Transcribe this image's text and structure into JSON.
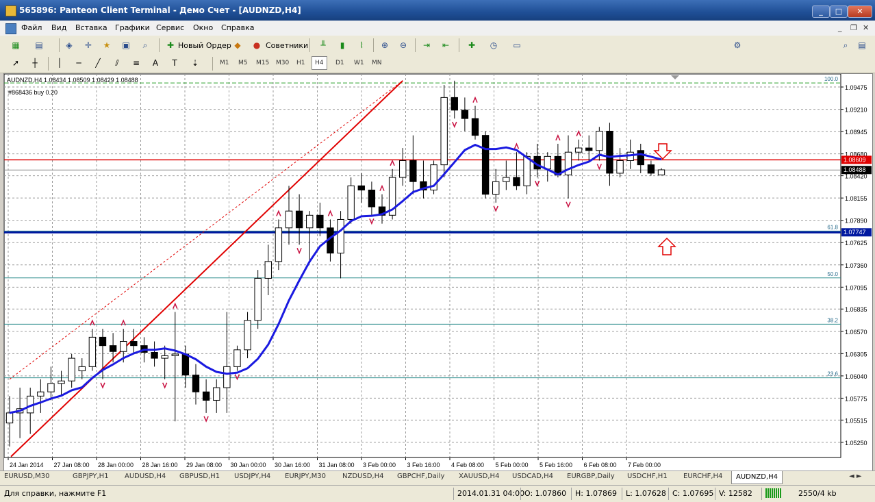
{
  "window": {
    "title": "565896: Panteon Client Terminal - Демо Счет - [AUDNZD,H4]"
  },
  "menu": [
    "Файл",
    "Вид",
    "Вставка",
    "Графики",
    "Сервис",
    "Окно",
    "Справка"
  ],
  "toolbar": {
    "new_order": "Новый Ордер",
    "advisors": "Советники"
  },
  "timeframes": [
    "M1",
    "M5",
    "M15",
    "M30",
    "H1",
    "H4",
    "D1",
    "W1",
    "MN"
  ],
  "active_timeframe": "H4",
  "chart_data": {
    "type": "candlestick",
    "header": "AUDNZD,H4  1.08434 1.08509 1.08429 1.08488",
    "order_label": "#868436 buy 0.20",
    "ylim": [
      1.0507,
      1.0963
    ],
    "y_ticks": [
      "1.09475",
      "1.09210",
      "1.08945",
      "1.08680",
      "1.08420",
      "1.08155",
      "1.07890",
      "1.07625",
      "1.07360",
      "1.07095",
      "1.06835",
      "1.06570",
      "1.06305",
      "1.06040",
      "1.05775",
      "1.05515",
      "1.05250"
    ],
    "x_ticks": [
      "24 Jan 2014",
      "27 Jan 08:00",
      "28 Jan 00:00",
      "28 Jan 16:00",
      "29 Jan 08:00",
      "30 Jan 00:00",
      "30 Jan 16:00",
      "31 Jan 08:00",
      "3 Feb 00:00",
      "3 Feb 16:00",
      "4 Feb 08:00",
      "5 Feb 00:00",
      "5 Feb 16:00",
      "6 Feb 08:00",
      "7 Feb 00:00"
    ],
    "fib_levels": [
      {
        "label": "100.0",
        "value": 1.09523
      },
      {
        "label": "61.8",
        "value": 1.07762
      },
      {
        "label": "50.0",
        "value": 1.07205
      },
      {
        "label": "38.2",
        "value": 1.06655
      },
      {
        "label": "23.6",
        "value": 1.06018
      }
    ],
    "price_lines": [
      {
        "label": "1.08609",
        "value": 1.08609,
        "color": "#e00000"
      },
      {
        "label": "1.08488",
        "value": 1.08488,
        "color": "#000000"
      },
      {
        "label": "1.07747",
        "value": 1.07747,
        "color": "#0018a0"
      }
    ],
    "candles": [
      [
        1.0548,
        1.058,
        1.052,
        1.056
      ],
      [
        1.056,
        1.059,
        1.053,
        1.0565
      ],
      [
        1.056,
        1.059,
        1.0535,
        1.058
      ],
      [
        1.058,
        1.06,
        1.056,
        1.0585
      ],
      [
        1.0585,
        1.0615,
        1.0575,
        1.0595
      ],
      [
        1.0595,
        1.061,
        1.058,
        1.0598
      ],
      [
        1.0598,
        1.063,
        1.059,
        1.0625
      ],
      [
        1.061,
        1.0625,
        1.06,
        1.0615
      ],
      [
        1.0615,
        1.066,
        1.061,
        1.065
      ],
      [
        1.065,
        1.066,
        1.06,
        1.064
      ],
      [
        1.064,
        1.0655,
        1.062,
        1.0633
      ],
      [
        1.0633,
        1.066,
        1.062,
        1.0645
      ],
      [
        1.0645,
        1.066,
        1.063,
        1.064
      ],
      [
        1.064,
        1.065,
        1.062,
        1.0632
      ],
      [
        1.0632,
        1.0645,
        1.0615,
        1.0625
      ],
      [
        1.0625,
        1.064,
        1.06,
        1.0628
      ],
      [
        1.0628,
        1.068,
        1.055,
        1.063
      ],
      [
        1.063,
        1.064,
        1.059,
        1.0605
      ],
      [
        1.0605,
        1.0618,
        1.057,
        1.0585
      ],
      [
        1.0585,
        1.06,
        1.056,
        1.0575
      ],
      [
        1.0575,
        1.06,
        1.056,
        1.059
      ],
      [
        1.059,
        1.068,
        1.056,
        1.0615
      ],
      [
        1.0615,
        1.064,
        1.061,
        1.0635
      ],
      [
        1.0635,
        1.068,
        1.0625,
        1.067
      ],
      [
        1.067,
        1.073,
        1.066,
        1.072
      ],
      [
        1.072,
        1.076,
        1.07,
        1.074
      ],
      [
        1.074,
        1.079,
        1.073,
        1.078
      ],
      [
        1.078,
        1.083,
        1.076,
        1.08
      ],
      [
        1.08,
        1.082,
        1.076,
        1.078
      ],
      [
        1.078,
        1.08,
        1.074,
        1.0795
      ],
      [
        1.0795,
        1.081,
        1.077,
        1.078
      ],
      [
        1.078,
        1.079,
        1.074,
        1.075
      ],
      [
        1.075,
        1.08,
        1.072,
        1.079
      ],
      [
        1.079,
        1.084,
        1.0785,
        1.083
      ],
      [
        1.083,
        1.0845,
        1.081,
        1.0825
      ],
      [
        1.0825,
        1.0835,
        1.0795,
        1.0805
      ],
      [
        1.0805,
        1.082,
        1.0785,
        1.0795
      ],
      [
        1.0795,
        1.085,
        1.079,
        1.084
      ],
      [
        1.084,
        1.0875,
        1.083,
        1.086
      ],
      [
        1.086,
        1.089,
        1.082,
        1.0835
      ],
      [
        1.0835,
        1.086,
        1.0815,
        1.0825
      ],
      [
        1.0825,
        1.086,
        1.082,
        1.0855
      ],
      [
        1.0855,
        1.095,
        1.084,
        1.0935
      ],
      [
        1.0935,
        1.0955,
        1.091,
        1.092
      ],
      [
        1.092,
        1.0935,
        1.0895,
        1.091
      ],
      [
        1.091,
        1.0925,
        1.0885,
        1.089
      ],
      [
        1.089,
        1.0895,
        1.0815,
        1.082
      ],
      [
        1.082,
        1.085,
        1.081,
        1.0835
      ],
      [
        1.0835,
        1.086,
        1.0825,
        1.084
      ],
      [
        1.084,
        1.087,
        1.0825,
        1.083
      ],
      [
        1.083,
        1.087,
        1.082,
        1.0865
      ],
      [
        1.0865,
        1.088,
        1.084,
        1.085
      ],
      [
        1.085,
        1.087,
        1.0835,
        1.0865
      ],
      [
        1.0865,
        1.088,
        1.084,
        1.0843
      ],
      [
        1.0843,
        1.089,
        1.0815,
        1.087
      ],
      [
        1.087,
        1.0885,
        1.086,
        1.0875
      ],
      [
        1.0875,
        1.089,
        1.086,
        1.0872
      ],
      [
        1.0872,
        1.09,
        1.086,
        1.0895
      ],
      [
        1.0895,
        1.0905,
        1.083,
        1.0845
      ],
      [
        1.0845,
        1.0875,
        1.084,
        1.086
      ],
      [
        1.086,
        1.0885,
        1.085,
        1.087
      ],
      [
        1.0872,
        1.088,
        1.0845,
        1.0855
      ],
      [
        1.0855,
        1.086,
        1.0842,
        1.0845
      ],
      [
        1.0843,
        1.0851,
        1.0843,
        1.0849
      ]
    ]
  },
  "tabs": [
    "EURUSD,M30",
    "GBPJPY,H1",
    "AUDUSD,H4",
    "GBPUSD,H1",
    "USDJPY,H4",
    "EURJPY,M30",
    "NZDUSD,H4",
    "GBPCHF,Daily",
    "XAUUSD,H4",
    "USDCAD,H4",
    "EURGBP,Daily",
    "USDCHF,H1",
    "EURCHF,H4",
    "AUDNZD,H4"
  ],
  "active_tab": "AUDNZD,H4",
  "status": {
    "help": "Для справки, нажмите F1",
    "time": "2014.01.31 04:00",
    "open": "O: 1.07860",
    "high": "H: 1.07869",
    "low": "L: 1.07628",
    "close": "C: 1.07695",
    "volume": "V: 12582",
    "traffic": "2550/4 kb"
  }
}
